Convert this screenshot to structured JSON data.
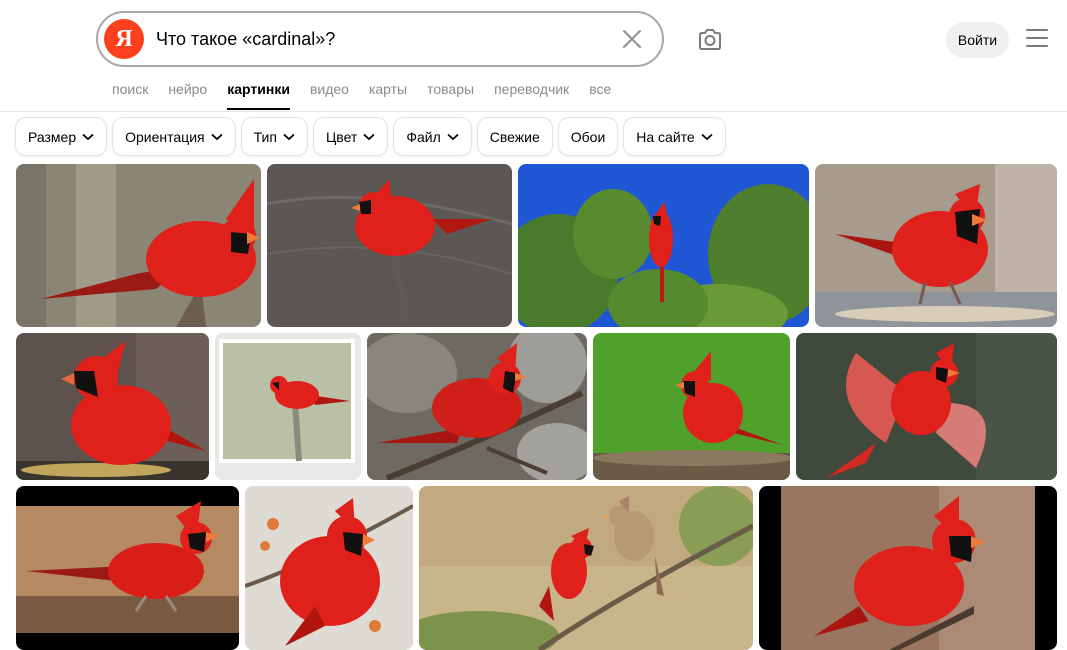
{
  "search": {
    "query": "Что такое «cardinal»?",
    "logo": "Я"
  },
  "header": {
    "login_label": "Войти"
  },
  "icons": {
    "clear": "close-icon",
    "camera": "camera-icon",
    "menu": "hamburger-icon",
    "chevron": "chevron-down-icon"
  },
  "tabs": [
    {
      "label": "поиск",
      "active": false
    },
    {
      "label": "нейро",
      "active": false
    },
    {
      "label": "картинки",
      "active": true
    },
    {
      "label": "видео",
      "active": false
    },
    {
      "label": "карты",
      "active": false
    },
    {
      "label": "товары",
      "active": false
    },
    {
      "label": "переводчик",
      "active": false
    },
    {
      "label": "все",
      "active": false
    }
  ],
  "filters": [
    {
      "label": "Размер",
      "dropdown": true
    },
    {
      "label": "Ориентация",
      "dropdown": true
    },
    {
      "label": "Тип",
      "dropdown": true
    },
    {
      "label": "Цвет",
      "dropdown": true
    },
    {
      "label": "Файл",
      "dropdown": true
    },
    {
      "label": "Свежие",
      "dropdown": false
    },
    {
      "label": "Обои",
      "dropdown": false
    },
    {
      "label": "На сайте",
      "dropdown": true
    }
  ],
  "colors": {
    "logo_red": "#fc3f1d",
    "cardinal_red": "#e0201a"
  }
}
